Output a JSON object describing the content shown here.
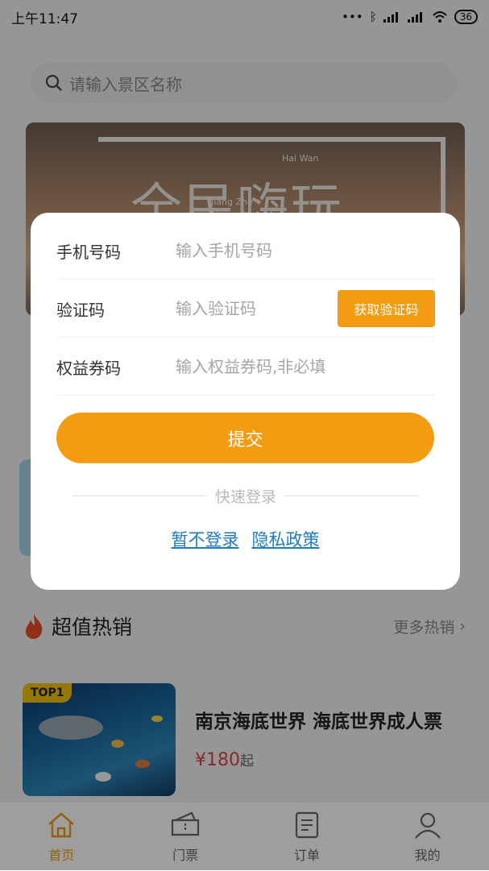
{
  "status_bar": {
    "time": "上午11:47",
    "battery": "36"
  },
  "search": {
    "placeholder": "请输入景区名称"
  },
  "banner": {
    "title": "全民嗨玩",
    "subtitle_en": "Hai Wan",
    "subtitle_pinyin": "Jiang Zhe"
  },
  "hot": {
    "title": "超值热销",
    "more_label": "更多热销"
  },
  "product": {
    "badge": "TOP1",
    "name": "南京海底世界 海底世界成人票",
    "price": "¥180",
    "price_suffix": "起"
  },
  "tabs": [
    {
      "label": "首页",
      "icon": "home-icon",
      "active": true
    },
    {
      "label": "门票",
      "icon": "ticket-icon",
      "active": false
    },
    {
      "label": "订单",
      "icon": "order-icon",
      "active": false
    },
    {
      "label": "我的",
      "icon": "user-icon",
      "active": false
    }
  ],
  "modal": {
    "phone_label": "手机号码",
    "phone_placeholder": "输入手机号码",
    "code_label": "验证码",
    "code_placeholder": "输入验证码",
    "get_code_label": "获取验证码",
    "coupon_label": "权益券码",
    "coupon_placeholder": "输入权益券码,非必填",
    "submit_label": "提交",
    "divider_text": "快速登录",
    "skip_login_label": "暂不登录",
    "privacy_label": "隐私政策"
  },
  "colors": {
    "accent": "#f39c12",
    "link": "#1f7bc0",
    "price": "#d64545"
  }
}
